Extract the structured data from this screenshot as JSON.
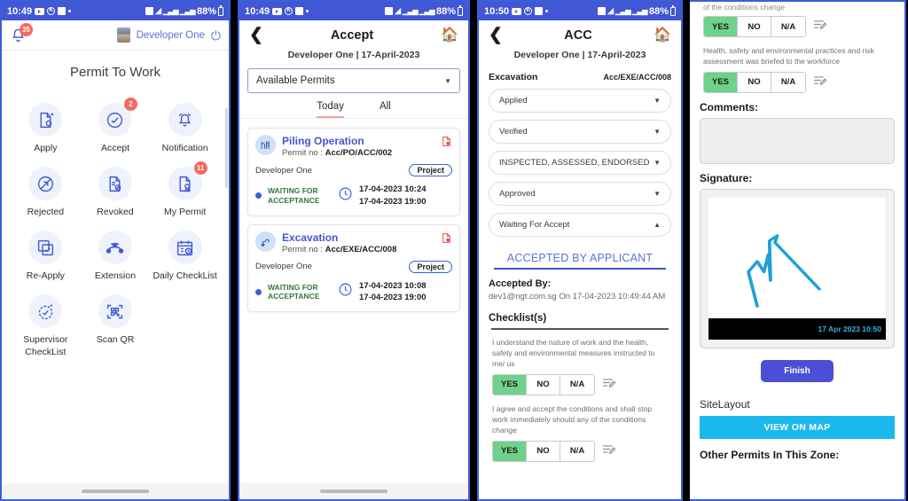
{
  "status_bar": {
    "time_1": "10:49",
    "time_3": "10:50",
    "battery": "88%",
    "icons": [
      "youtube-icon",
      "k-circle-icon",
      "inbox-icon",
      "dot-icon",
      "alarm-icon",
      "wifi-icon",
      "signal-icon",
      "battery-icon"
    ]
  },
  "panel1": {
    "notification_badge": "35",
    "user_name": "Developer One",
    "page_title": "Permit To Work",
    "tiles": [
      {
        "label": "Apply",
        "icon": "document-add-icon",
        "badge": ""
      },
      {
        "label": "Accept",
        "icon": "check-circle-icon",
        "badge": "2"
      },
      {
        "label": "Notification",
        "icon": "bell-ring-icon",
        "badge": ""
      },
      {
        "label": "Rejected",
        "icon": "no-entry-icon",
        "badge": ""
      },
      {
        "label": "Revoked",
        "icon": "document-cancel-icon",
        "badge": ""
      },
      {
        "label": "My Permit",
        "icon": "document-award-icon",
        "badge": "11"
      },
      {
        "label": "Re-Apply",
        "icon": "copy-check-icon",
        "badge": ""
      },
      {
        "label": "Extension",
        "icon": "node-curve-icon",
        "badge": ""
      },
      {
        "label": "Daily CheckList",
        "icon": "calendar-clock-icon",
        "badge": ""
      },
      {
        "label": "Supervisor\nCheckList",
        "icon": "stopwatch-check-icon",
        "badge": ""
      },
      {
        "label": "Scan QR",
        "icon": "qr-scan-icon",
        "badge": ""
      }
    ]
  },
  "panel2": {
    "title": "Accept",
    "subheader": "Developer One | 17-April-2023",
    "filter_value": "Available Permits",
    "tabs": [
      {
        "label": "Today",
        "active": true
      },
      {
        "label": "All",
        "active": false
      }
    ],
    "cards": [
      {
        "name": "Piling Operation",
        "permit_no_label": "Permit no :",
        "permit_no": "Acc/PO/ACC/002",
        "developer": "Developer One",
        "chip": "Project",
        "status": "WAITING FOR ACCEPTANCE",
        "date_start": "17-04-2023 10:24",
        "date_end": "17-04-2023 19:00",
        "icon": "piling-rig-icon"
      },
      {
        "name": "Excavation",
        "permit_no_label": "Permit no :",
        "permit_no": "Acc/EXE/ACC/008",
        "developer": "Developer One",
        "chip": "Project",
        "status": "WAITING FOR ACCEPTANCE",
        "date_start": "17-04-2023 10:08",
        "date_end": "17-04-2023 19:00",
        "icon": "excavator-icon"
      }
    ]
  },
  "panel3": {
    "title": "ACC",
    "subheader": "Developer One | 17-April-2023",
    "work_type": "Excavation",
    "permit_no": "Acc/EXE/ACC/008",
    "stages": [
      {
        "label": "Applied",
        "open": false
      },
      {
        "label": "Verified",
        "open": false
      },
      {
        "label": "INSPECTED, ASSESSED, ENDORSED",
        "open": false
      },
      {
        "label": "Approved",
        "open": false
      },
      {
        "label": "Waiting For Accept",
        "open": true
      }
    ],
    "accepted_heading": "ACCEPTED BY APPLICANT",
    "accepted_by_label": "Accepted By:",
    "accepted_by_value": "dev1@ngt.com.sg On 17-04-2023 10:49:44 AM",
    "checklist_heading": "Checklist(s)",
    "checklist": [
      {
        "question": "I understand the nature of work and the health, safety and environmental measures instructed to me/ us",
        "options": [
          "YES",
          "NO",
          "N/A"
        ],
        "selected": "YES"
      },
      {
        "question": "I agree and accept the conditions and shall stop work immediately should any of the conditions change",
        "options": [
          "YES",
          "NO",
          "N/A"
        ],
        "selected": "YES"
      }
    ]
  },
  "panel4": {
    "cut_text": "of the conditions change",
    "checklist": [
      {
        "question": "",
        "options": [
          "YES",
          "NO",
          "N/A"
        ],
        "selected": "YES"
      },
      {
        "question": "Health, safety and environmental practices and risk assessment was briefed to the workforce",
        "options": [
          "YES",
          "NO",
          "N/A"
        ],
        "selected": "YES"
      }
    ],
    "comments_label": "Comments:",
    "comments_value": "",
    "signature_label": "Signature:",
    "signature_timestamp": "17 Apr 2023 10:50",
    "finish_label": "Finish",
    "sitelayout_label": "SiteLayout",
    "view_on_map_label": "VIEW ON MAP",
    "other_permits_label": "Other Permits In This Zone:"
  }
}
